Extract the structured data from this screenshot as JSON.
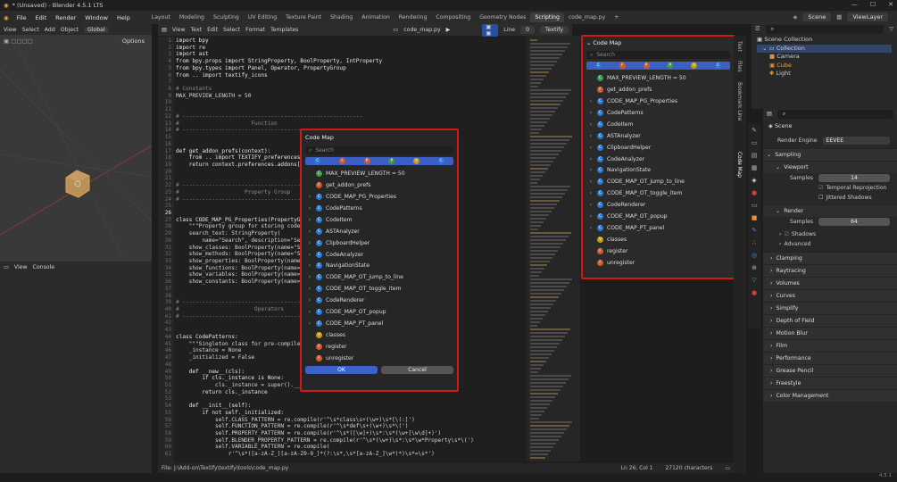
{
  "window": {
    "title": "* (Unsaved) - Blender 4.5.1 LTS",
    "controls": [
      "—",
      "☐",
      "✕"
    ]
  },
  "menu": {
    "items": [
      "File",
      "Edit",
      "Render",
      "Window",
      "Help"
    ]
  },
  "workspaces": [
    "Layout",
    "Modeling",
    "Sculpting",
    "UV Editing",
    "Texture Paint",
    "Shading",
    "Animation",
    "Rendering",
    "Compositing",
    "Geometry Nodes",
    "Scripting",
    "code_map.py"
  ],
  "topright": {
    "scene": "Scene",
    "viewlayer": "ViewLayer"
  },
  "viewport": {
    "menu": [
      "View",
      "Select",
      "Add",
      "Object"
    ],
    "orientation": "Global",
    "options": "Options"
  },
  "console": {
    "menu": [
      "View",
      "Console"
    ]
  },
  "editor": {
    "menu": [
      "View",
      "Text",
      "Edit",
      "Select",
      "Format",
      "Templates"
    ],
    "filename": "code_map.py",
    "line_label": "Line",
    "line_value": "0",
    "mode": "Textify"
  },
  "code": {
    "line_numbers": [
      "1",
      "2",
      "3",
      "4",
      "5",
      "6",
      "7",
      "8",
      "9",
      "10",
      "11",
      "12",
      "13",
      "14",
      "15",
      "16",
      "17",
      "18",
      "19",
      "20",
      "21",
      "22",
      "23",
      "24",
      "25",
      "26",
      "27",
      "28",
      "29",
      "30",
      "31",
      "32",
      "33",
      "34",
      "35",
      "36",
      "37",
      "38",
      "39",
      "40",
      "41",
      "42",
      "43",
      "44",
      "45",
      "46",
      "47",
      "48",
      "49",
      "50",
      "51",
      "52",
      "53",
      "54",
      "55",
      "56",
      "57",
      "58",
      "59",
      "60",
      "61"
    ],
    "lines": [
      "import bpy",
      "import re",
      "import ast",
      "from bpy.props import StringProperty, BoolProperty, IntProperty",
      "from bpy.types import Panel, Operator, PropertyGroup",
      "from .. import textify_icons",
      "",
      "# Constants",
      "MAX_PREVIEW_LENGTH = 50",
      "",
      "",
      "# -------------------------------------------------------",
      "#                      Function",
      "# -------------------------------------------------------",
      "",
      "",
      "def get_addon_prefs(context):",
      "    from .. import TEXTIFY_preferences",
      "    return context.preferences.addons[",
      "",
      "",
      "# -------------------------------------------------------",
      "#                    Property Group",
      "# -------------------------------------------------------",
      "",
      "",
      "class CODE_MAP_PG_Properties(PropertyGr",
      "    \"\"\"Property group for storing code",
      "    search_text: StringProperty(",
      "        name=\"Search\", description=\"Se                             fault=\"\", options=",
      "    show_classes: BoolProperty(name=\"S",
      "    show_methods: BoolProperty(name=\"S",
      "    show_properties: BoolProperty(name=",
      "    show_functions: BoolProperty(name=",
      "    show_variables: BoolProperty(name=",
      "    show_constants: BoolProperty(name=",
      "",
      "",
      "# -------------------------------------------------------",
      "#                       Operators",
      "# -------------------------------------------------------",
      "",
      "",
      "class CodePatterns:",
      "    \"\"\"Singleton class for pre-compile",
      "    _instance = None",
      "    _initialized = False",
      "",
      "    def __new__(cls):",
      "        if cls._instance is None:",
      "            cls._instance = super().__",
      "        return cls._instance",
      "",
      "    def __init__(self):",
      "        if not self._initialized:",
      "            self.CLASS_PATTERN = re.compile(r'^\\s*class\\s+(\\w+)\\s*[\\(:]')",
      "            self.FUNCTION_PATTERN = re.compile(r'^\\s*def\\s+(\\w+)\\s*\\(')",
      "            self.PROPERTY_PATTERN = re.compile(r'^\\s*([\\w]+)\\s*:\\s*(\\w+[\\w\\d]+)')",
      "            self.BLENDER_PROPERTY_PATTERN = re.compile(r'^\\s*(\\w+)\\s*:\\s*\\w*Property\\s*\\(')",
      "            self.VARIABLE_PATTERN = re.compile(",
      "                r'^\\s*([a-zA-Z_][a-zA-Z0-9_]*(?:\\s*,\\s*[a-zA-Z_]\\w*)*)\\s*=\\s*')"
    ]
  },
  "codemap": {
    "title": "Code Map",
    "search_placeholder": "Search",
    "filters": [
      "C",
      "F",
      "P",
      "P",
      "V",
      "C"
    ],
    "items": [
      {
        "icon": "C",
        "label": "MAX_PREVIEW_LENGTH = 50",
        "color": "#3a9a48",
        "expand": false
      },
      {
        "icon": "F",
        "label": "get_addon_prefs",
        "color": "#d05a2a",
        "expand": false
      },
      {
        "icon": "C",
        "label": "CODE_MAP_PG_Properties",
        "color": "#2a7ad4",
        "expand": true
      },
      {
        "icon": "C",
        "label": "CodePatterns",
        "color": "#2a7ad4",
        "expand": true
      },
      {
        "icon": "C",
        "label": "CodeItem",
        "color": "#2a7ad4",
        "expand": true
      },
      {
        "icon": "C",
        "label": "ASTAnalyzer",
        "color": "#2a7ad4",
        "expand": true
      },
      {
        "icon": "C",
        "label": "ClipboardHelper",
        "color": "#2a7ad4",
        "expand": true
      },
      {
        "icon": "C",
        "label": "CodeAnalyzer",
        "color": "#2a7ad4",
        "expand": true
      },
      {
        "icon": "C",
        "label": "NavigationState",
        "color": "#2a7ad4",
        "expand": true
      },
      {
        "icon": "C",
        "label": "CODE_MAP_OT_jump_to_line",
        "color": "#2a7ad4",
        "expand": true
      },
      {
        "icon": "C",
        "label": "CODE_MAP_OT_toggle_item",
        "color": "#2a7ad4",
        "expand": true
      },
      {
        "icon": "C",
        "label": "CodeRenderer",
        "color": "#2a7ad4",
        "expand": true
      },
      {
        "icon": "C",
        "label": "CODE_MAP_OT_popup",
        "color": "#2a7ad4",
        "expand": true
      },
      {
        "icon": "C",
        "label": "CODE_MAP_PT_panel",
        "color": "#2a7ad4",
        "expand": true
      },
      {
        "icon": "V",
        "label": "classes",
        "color": "#c79a10",
        "expand": false
      },
      {
        "icon": "F",
        "label": "register",
        "color": "#d05a2a",
        "expand": false
      },
      {
        "icon": "F",
        "label": "unregister",
        "color": "#d05a2a",
        "expand": false
      }
    ],
    "ok_label": "OK",
    "cancel_label": "Cancel"
  },
  "sidetabs": [
    "Text",
    "Files",
    "Bookmark Line",
    "Code Map"
  ],
  "outliner": {
    "root": "Scene Collection",
    "collection": "Collection",
    "objects": [
      "Camera",
      "Cube",
      "Light"
    ]
  },
  "properties": {
    "scene": "Scene",
    "render_engine_label": "Render Engine",
    "render_engine": "EEVEE",
    "sampling": "Sampling",
    "viewport": "Viewport",
    "samples_label": "Samples",
    "viewport_samples": "14",
    "temporal": "Temporal Reprojection",
    "jittered": "Jittered Shadows",
    "render": "Render",
    "render_samples": "64",
    "shadows": "Shadows",
    "advanced": "Advanced",
    "sections": [
      "Clamping",
      "Raytracing",
      "Volumes",
      "Curves",
      "Simplify",
      "Depth of Field",
      "Motion Blur",
      "Film",
      "Performance",
      "Grease Pencil",
      "Freestyle",
      "Color Management"
    ]
  },
  "status": {
    "file": "File: J:\\Add-on\\Textify\\textify\\tools\\code_map.py",
    "position": "Ln 26, Col 1",
    "chars": "27120 characters",
    "version": "4.5.1"
  }
}
